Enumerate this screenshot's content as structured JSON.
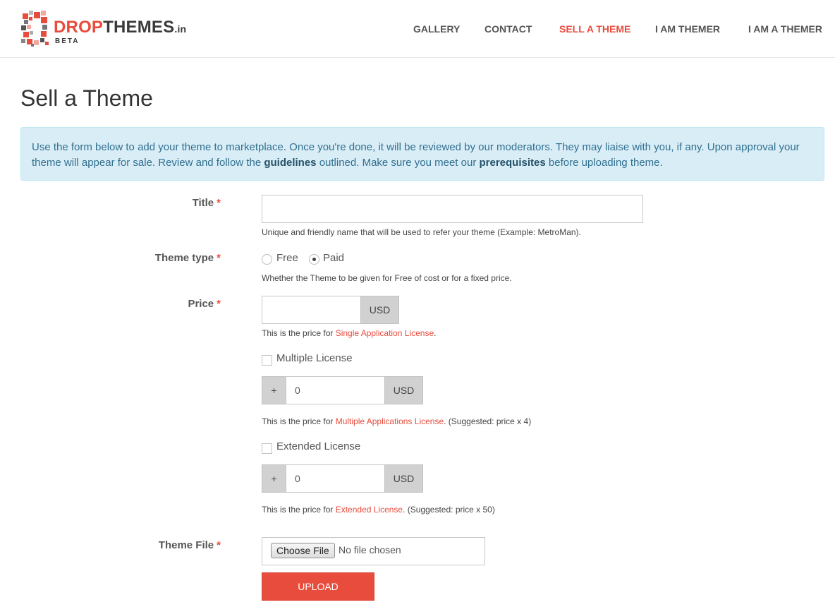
{
  "brand": {
    "name_part1": "DROP",
    "name_part2": "THEMES",
    "tld": ".in",
    "tag": "BETA",
    "color_primary": "#e84c3d"
  },
  "nav": {
    "items": [
      {
        "label": "GALLERY"
      },
      {
        "label": "CONTACT"
      },
      {
        "label": "SELL A THEME",
        "active": true
      },
      {
        "label": "I AM THEMER"
      },
      {
        "label": "I AM A THEMER"
      }
    ]
  },
  "page": {
    "title": "Sell a Theme"
  },
  "info": {
    "text_1": "Use the form below to add your theme to marketplace. Once you're done, it will be reviewed by our moderators. They may liaise with you, if any. Upon approval your theme will appear for sale. Review and follow the ",
    "link_guidelines": "guidelines",
    "text_2": " outlined. Make sure you meet our ",
    "link_prerequisites": "prerequisites",
    "text_3": " before uploading theme."
  },
  "form": {
    "required_marker": "*",
    "title": {
      "label": "Title",
      "value": "",
      "help": "Unique and friendly name that will be used to refer your theme (Example: MetroMan)."
    },
    "theme_type": {
      "label": "Theme type",
      "options": [
        {
          "label": "Free",
          "checked": false
        },
        {
          "label": "Paid",
          "checked": true
        }
      ],
      "help": "Whether the Theme to be given for Free of cost or for a fixed price."
    },
    "price": {
      "label": "Price",
      "value": "",
      "currency": "USD",
      "help_prefix": "This is the price for ",
      "help_link": "Single Application License",
      "help_suffix": "."
    },
    "multiple_license": {
      "label": "Multiple License",
      "checked": false,
      "prefix": "+",
      "value": "0",
      "currency": "USD",
      "help_prefix": "This is the price for ",
      "help_link": "Multiple Applications License",
      "help_suffix": ". (Suggested: price x 4)"
    },
    "extended_license": {
      "label": "Extended License",
      "checked": false,
      "prefix": "+",
      "value": "0",
      "currency": "USD",
      "help_prefix": "This is the price for ",
      "help_link": "Extended License",
      "help_suffix": ". (Suggested: price x 50)"
    },
    "theme_file": {
      "label": "Theme File",
      "button": "Choose File",
      "status": "No file chosen"
    },
    "upload_label": "UPLOAD"
  }
}
